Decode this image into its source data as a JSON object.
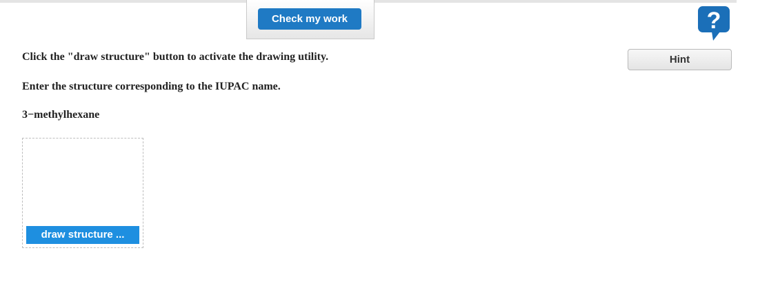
{
  "toolbar": {
    "check_label": "Check my work",
    "help_icon": "question-mark-icon",
    "help_glyph": "?"
  },
  "question": {
    "instruction_draw": "Click the \"draw structure\" button to activate the drawing utility.",
    "instruction_enter": "Enter the structure corresponding to the IUPAC name.",
    "compound_name": "3−methylhexane"
  },
  "hint": {
    "label": "Hint"
  },
  "drawing": {
    "button_label": "draw structure ..."
  },
  "colors": {
    "primary_blue": "#1f7ac4",
    "draw_button_blue": "#1e8fe0",
    "help_icon_blue": "#1b6fb8"
  }
}
